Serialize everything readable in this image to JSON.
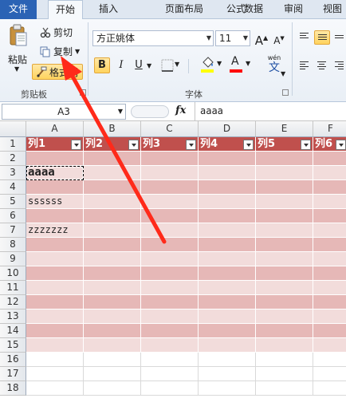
{
  "tabs": [
    "文件",
    "开始",
    "插入",
    "页面布局",
    "公式",
    "数据",
    "审阅",
    "视图"
  ],
  "ribbon": {
    "clipboard": {
      "paste_label": "粘贴",
      "cut_label": "剪切",
      "copy_label": "复制",
      "format_painter_label": "格式刷",
      "group_label": "剪贴板"
    },
    "font": {
      "font_name": "方正姚体",
      "font_size": "11",
      "grow_label": "A",
      "shrink_label": "A",
      "bold_label": "B",
      "italic_label": "I",
      "underline_label": "U",
      "font_color_label": "A",
      "phonetic_label": "文",
      "phonetic_top": "wén",
      "group_label": "字体",
      "fill_color": "#ffff00",
      "font_color": "#ff0000"
    }
  },
  "formula_bar": {
    "name_box": "A3",
    "fx_label": "fx",
    "formula": "aaaa"
  },
  "grid": {
    "columns": [
      "A",
      "B",
      "C",
      "D",
      "E",
      "F"
    ],
    "rows": [
      "1",
      "2",
      "3",
      "4",
      "5",
      "6",
      "7",
      "8",
      "9",
      "10",
      "11",
      "12",
      "13",
      "14",
      "15",
      "16",
      "17",
      "18"
    ],
    "header_labels": [
      "列1",
      "列2",
      "列3",
      "列4",
      "列5",
      "列6"
    ],
    "cells": {
      "A3": "aaaa",
      "A5": "ssssss",
      "A7": "zzzzzzz"
    },
    "header_color": "#c0504d",
    "band_dark": "#e6b8b7",
    "band_light": "#f2dcdb"
  },
  "annotation": {
    "arrow_color": "#ff2a1a"
  }
}
